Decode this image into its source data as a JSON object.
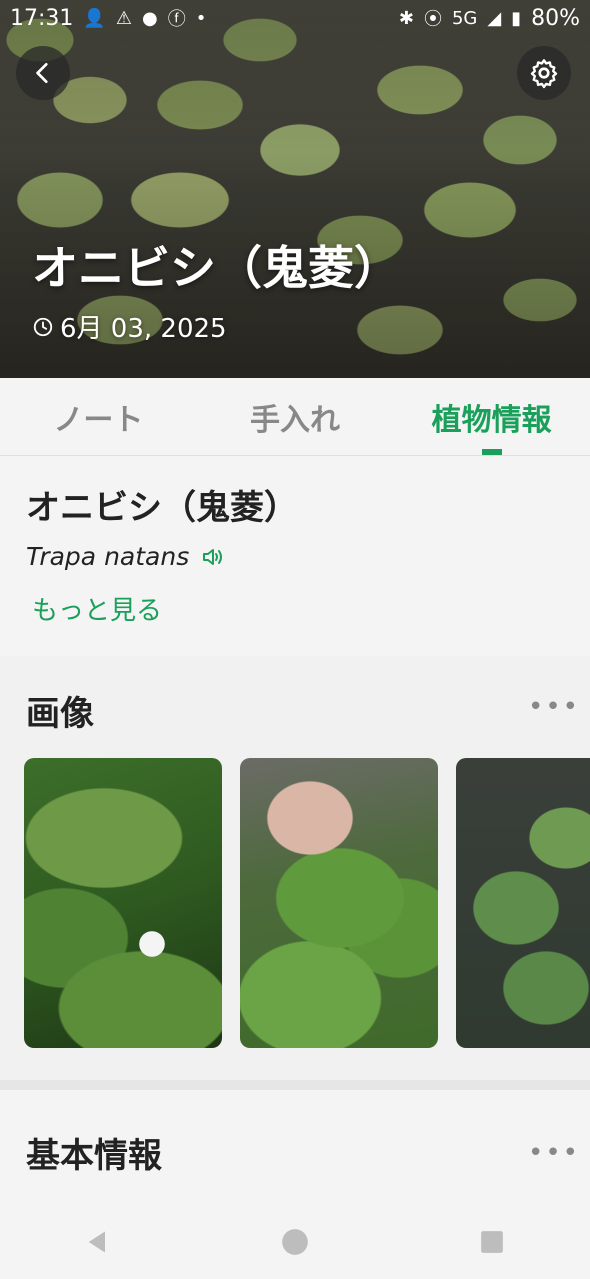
{
  "status": {
    "time": "17:31",
    "network": "5G",
    "battery": "80%"
  },
  "hero": {
    "title": "オニビシ（鬼菱）",
    "date": "6月 03, 2025"
  },
  "tabs": [
    {
      "label": "ノート"
    },
    {
      "label": "手入れ"
    },
    {
      "label": "植物情報"
    }
  ],
  "plant": {
    "name": "オニビシ（鬼菱）",
    "scientific_name": "Trapa natans",
    "more_label": "もっと見る"
  },
  "images_section": {
    "title": "画像",
    "menu": "•••"
  },
  "basic_section": {
    "title": "基本情報",
    "menu": "•••"
  },
  "colors": {
    "accent": "#1aa05a"
  }
}
